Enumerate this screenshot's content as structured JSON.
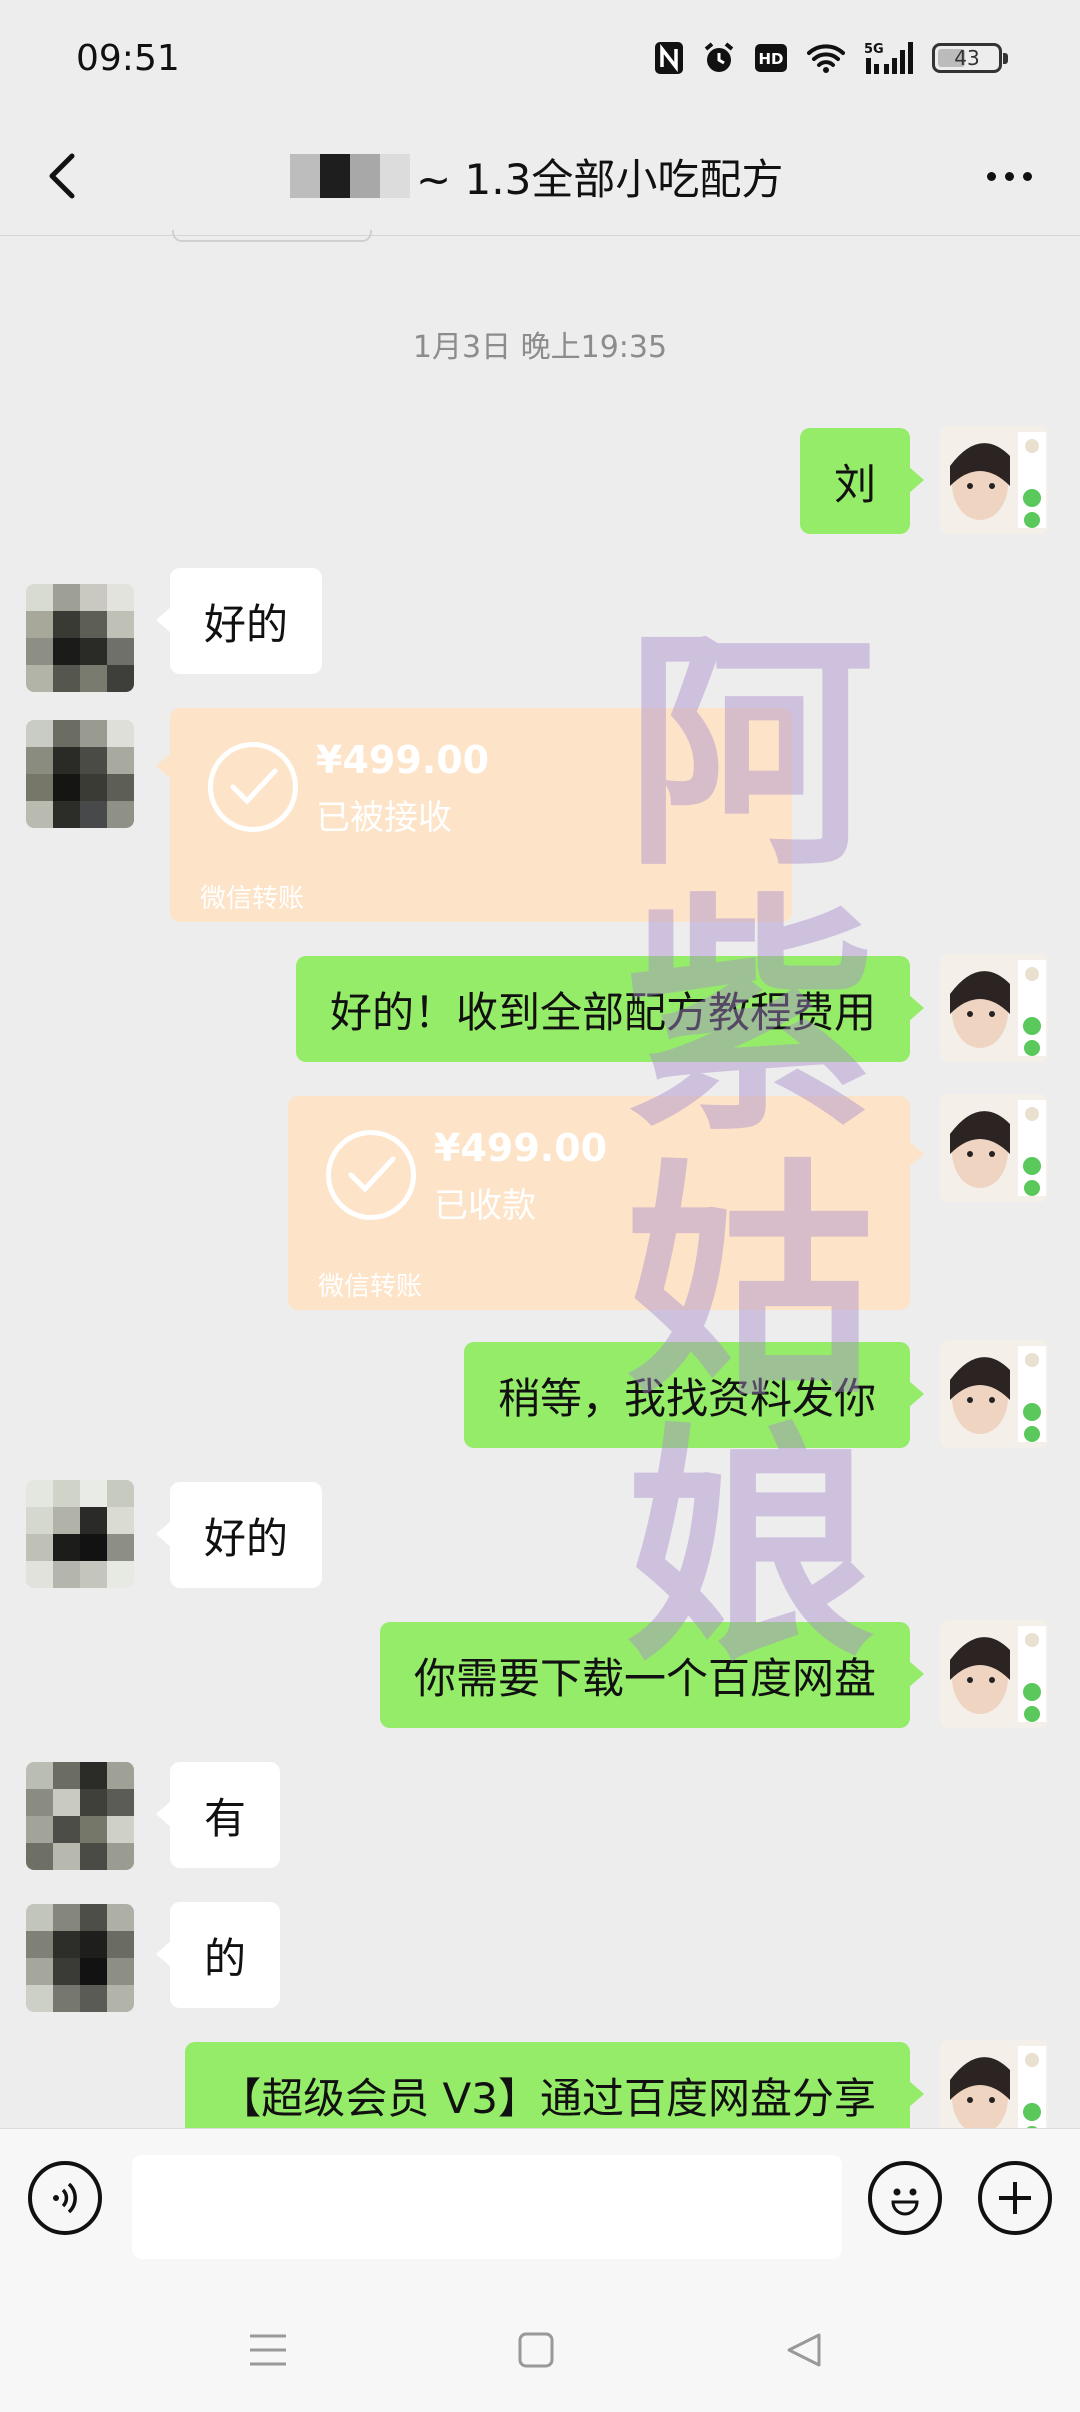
{
  "status_bar": {
    "time": "09:51",
    "icons": [
      "nfc-icon",
      "alarm-icon",
      "hd-icon",
      "wifi-icon",
      "5g-signal-icon",
      "battery-icon"
    ],
    "network": "5G",
    "battery": "43"
  },
  "header": {
    "title": "~ 1.3全部小吃配方",
    "back_icon": "chevron-left-icon",
    "more_icon": "more-dots-icon"
  },
  "chat": {
    "timestamp": "1月3日 晚上19:35",
    "messages": [
      {
        "from": "me",
        "type": "text",
        "text": "刘"
      },
      {
        "from": "other",
        "type": "text",
        "text": "好的"
      },
      {
        "from": "other",
        "type": "transfer",
        "amount": "¥499.00",
        "status": "已被接收",
        "label": "微信转账"
      },
      {
        "from": "me",
        "type": "text",
        "text": "好的！收到全部配方教程费用"
      },
      {
        "from": "me",
        "type": "transfer",
        "amount": "¥499.00",
        "status": "已收款",
        "label": "微信转账"
      },
      {
        "from": "me",
        "type": "text",
        "text": "稍等，我找资料发你"
      },
      {
        "from": "other",
        "type": "text",
        "text": "好的"
      },
      {
        "from": "me",
        "type": "text",
        "text": "你需要下载一个百度网盘"
      },
      {
        "from": "other",
        "type": "text",
        "text": "有"
      },
      {
        "from": "other",
        "type": "text",
        "text": "的"
      },
      {
        "from": "me",
        "type": "text",
        "text": "【超级会员 V3】通过百度网盘分享"
      }
    ]
  },
  "watermark": [
    "阿",
    "紫",
    "姑",
    "娘"
  ],
  "input_bar": {
    "voice_icon": "voice-icon",
    "input_value": "",
    "emoji_icon": "emoji-icon",
    "add_icon": "plus-icon"
  },
  "nav_bar": {
    "icons": [
      "menu-icon",
      "home-square-icon",
      "back-triangle-icon"
    ]
  },
  "colors": {
    "background": "#ededed",
    "my_bubble": "#95ec69",
    "other_bubble": "#ffffff",
    "transfer_card": "#fde4c8",
    "watermark": "#a88ccd"
  }
}
